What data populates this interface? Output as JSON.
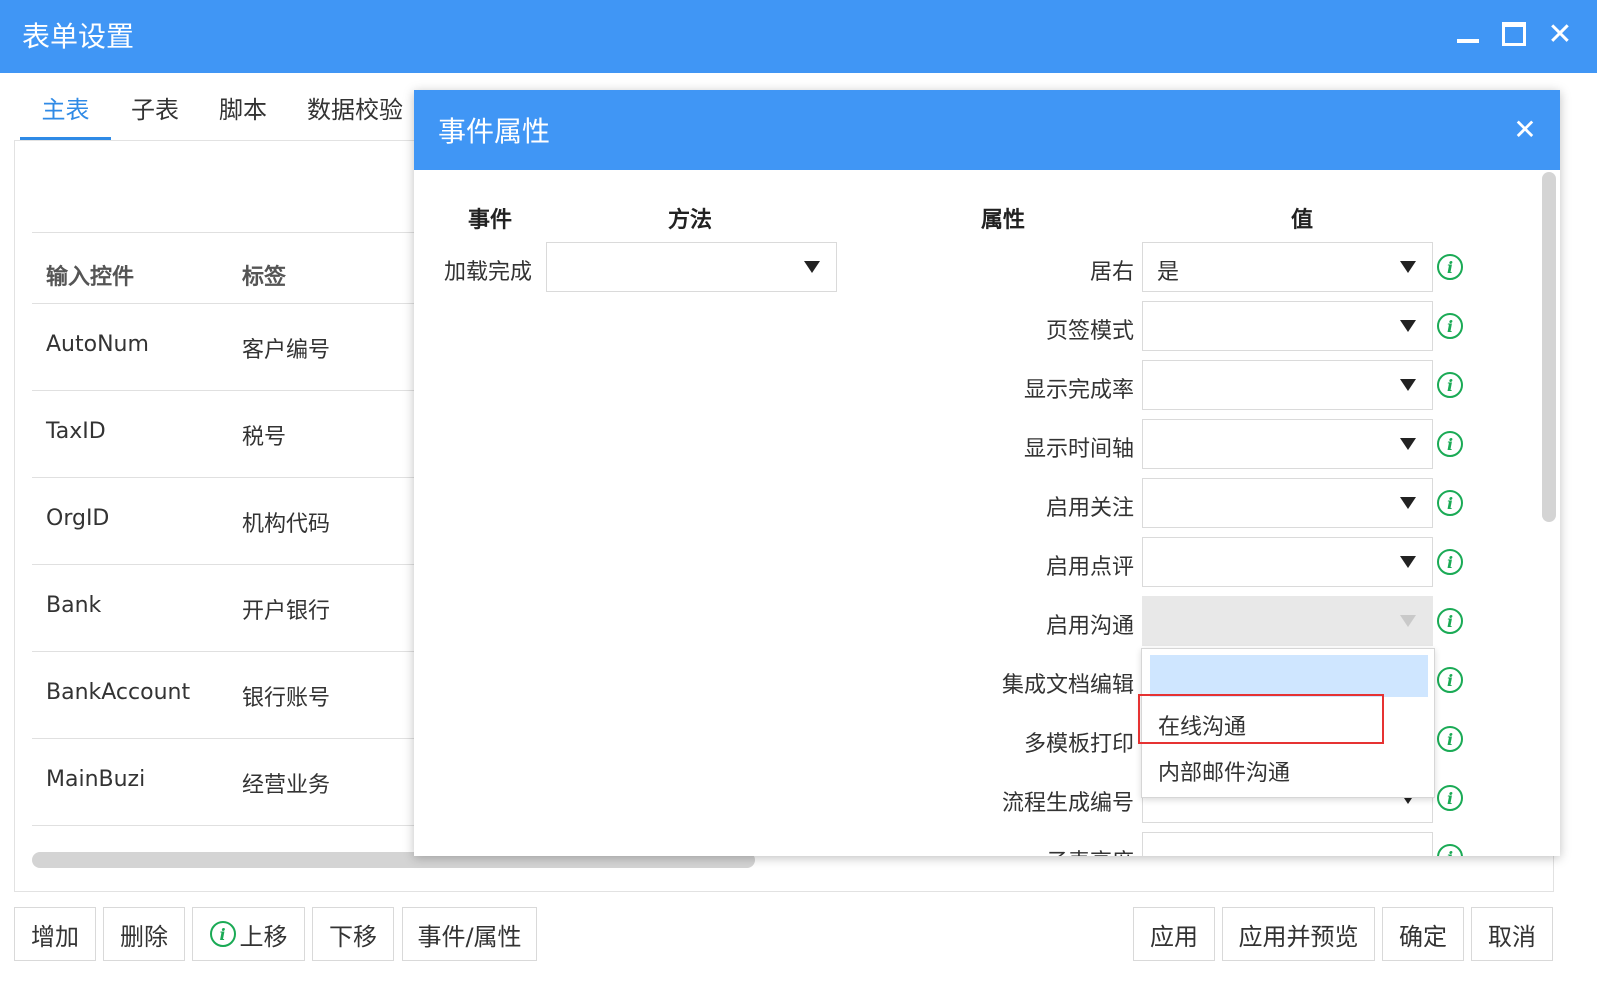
{
  "window": {
    "title": "表单设置"
  },
  "tabs": [
    {
      "label": "主表",
      "active": true
    },
    {
      "label": "子表",
      "active": false
    },
    {
      "label": "脚本",
      "active": false
    },
    {
      "label": "数据校验",
      "active": false
    }
  ],
  "table": {
    "headers": [
      "输入控件",
      "标签"
    ],
    "rows": [
      {
        "control": "AutoNum",
        "label": "客户编号"
      },
      {
        "control": "TaxID",
        "label": "税号"
      },
      {
        "control": "OrgID",
        "label": "机构代码"
      },
      {
        "control": "Bank",
        "label": "开户银行"
      },
      {
        "control": "BankAccount",
        "label": "银行账号"
      },
      {
        "control": "MainBuzi",
        "label": "经营业务"
      }
    ]
  },
  "footer": {
    "left_buttons": [
      "增加",
      "删除",
      "上移",
      "下移",
      "事件/属性"
    ],
    "right_buttons": [
      "应用",
      "应用并预览",
      "确定",
      "取消"
    ]
  },
  "dialog": {
    "title": "事件属性",
    "headers": {
      "event": "事件",
      "method": "方法",
      "property": "属性",
      "value": "值"
    },
    "event": {
      "label": "加载完成",
      "value": ""
    },
    "properties": [
      {
        "label": "居右",
        "value": "是"
      },
      {
        "label": "页签模式",
        "value": ""
      },
      {
        "label": "显示完成率",
        "value": ""
      },
      {
        "label": "显示时间轴",
        "value": ""
      },
      {
        "label": "启用关注",
        "value": ""
      },
      {
        "label": "启用点评",
        "value": ""
      },
      {
        "label": "启用沟通",
        "value": ""
      },
      {
        "label": "集成文档编辑",
        "value": ""
      },
      {
        "label": "多模板打印",
        "value": ""
      },
      {
        "label": "流程生成编号",
        "value": ""
      },
      {
        "label": "子表高度",
        "value": ""
      }
    ],
    "dropdown_options": [
      "",
      "在线沟通",
      "内部邮件沟通"
    ]
  },
  "colors": {
    "titlebar": "#4096f5",
    "tab_active": "#2f8ae6",
    "info_icon": "#1aaa55",
    "dropdown_selected": "#cfe6ff",
    "highlight_border": "#e63232"
  },
  "icons": {
    "minimize": "minimize-icon",
    "maximize": "maximize-icon",
    "close": "close-icon",
    "info": "info-icon",
    "dropdown": "chevron-down-icon"
  }
}
